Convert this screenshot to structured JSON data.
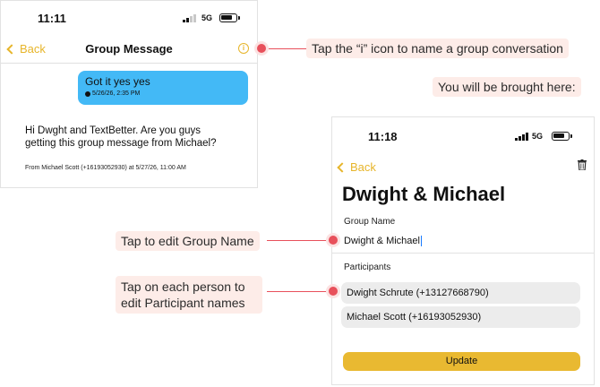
{
  "screen1": {
    "status": {
      "time": "11:11",
      "network": "5G"
    },
    "nav": {
      "back_label": "Back",
      "title": "Group Message",
      "info_icon": "info-icon"
    },
    "sent_message": {
      "text": "Got it yes yes",
      "timestamp": "5/26/26, 2:35 PM"
    },
    "received_message": {
      "text": "Hi Dwght and TextBetter. Are you guys getting this group message from Michael?",
      "meta": "From Michael Scott (+16193052930) at 5/27/26, 11:00 AM"
    }
  },
  "screen2": {
    "status": {
      "time": "11:18",
      "network": "5G"
    },
    "nav": {
      "back_label": "Back",
      "trash_icon": "trash-icon"
    },
    "title": "Dwight & Michael",
    "group_name_label": "Group Name",
    "group_name_value": "Dwight & Michael",
    "participants_label": "Participants",
    "participants": [
      "Dwight Schrute (+13127668790)",
      "Michael Scott (+16193052930)"
    ],
    "update_label": "Update"
  },
  "callouts": {
    "tap_info": "Tap the “i” icon to name a group conversation",
    "brought_here": "You will  be brought here:",
    "edit_group_name": "Tap to edit Group Name",
    "edit_participants_line1": "Tap on each person to",
    "edit_participants_line2": "edit Participant names"
  },
  "colors": {
    "accent": "#e7b52a",
    "bubble": "#43b9f6",
    "callout_bg": "#fdece8",
    "marker": "#e8505b",
    "update_button": "#e9b931"
  }
}
